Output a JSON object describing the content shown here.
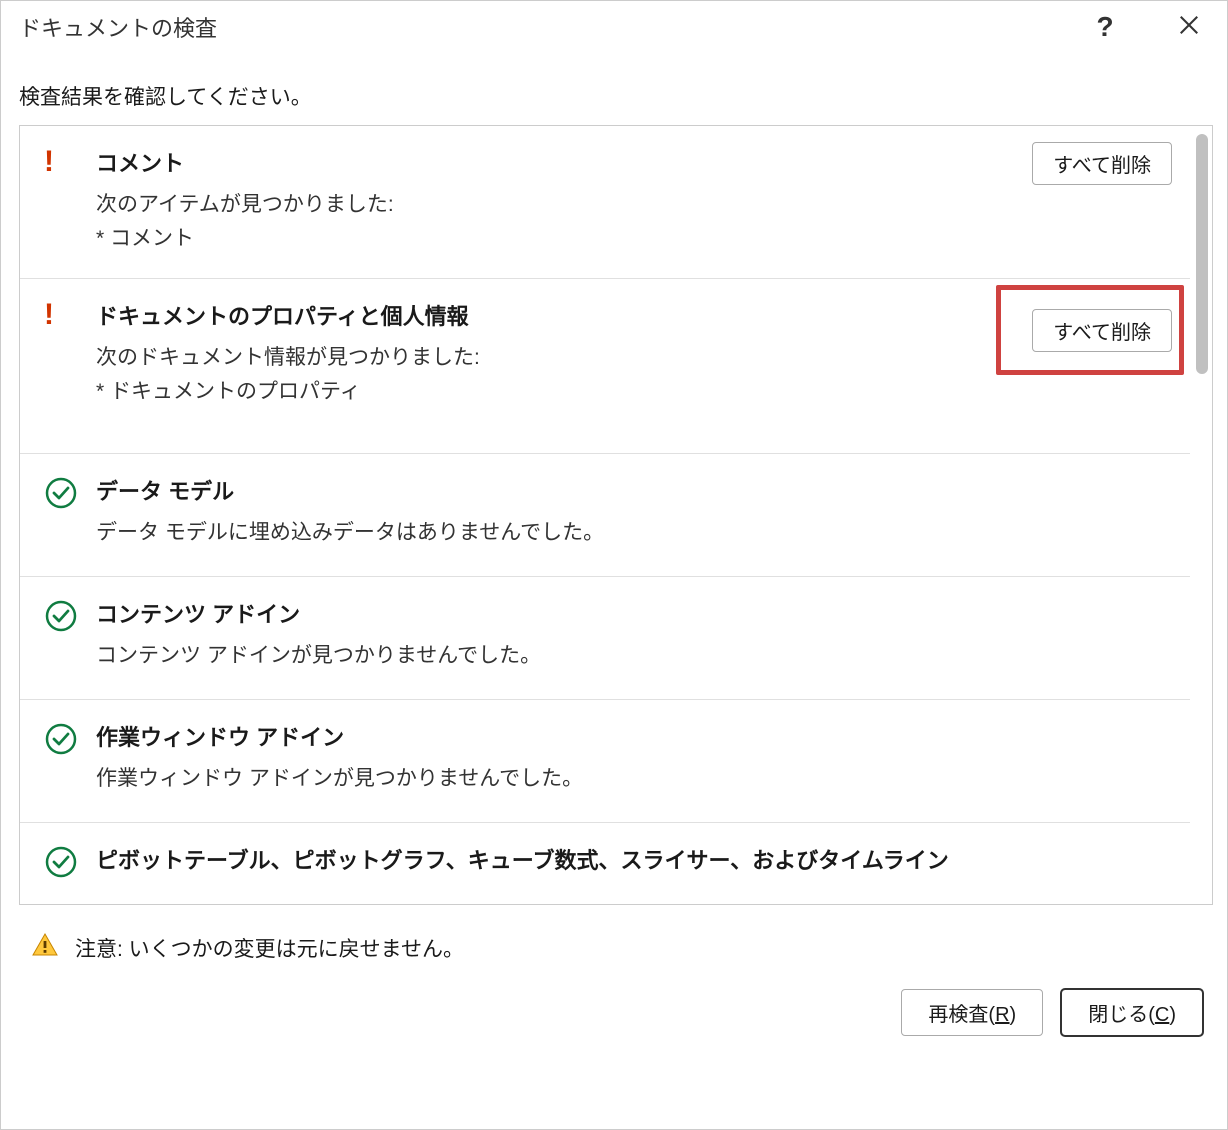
{
  "dialog": {
    "title": "ドキュメントの検査",
    "help_symbol": "?",
    "instruction": "検査結果を確認してください。"
  },
  "results": [
    {
      "status": "found",
      "title": "コメント",
      "description": "次のアイテムが見つかりました:",
      "detail": "* コメント",
      "remove_label": "すべて削除",
      "highlighted": false
    },
    {
      "status": "found",
      "title": "ドキュメントのプロパティと個人情報",
      "description": "次のドキュメント情報が見つかりました:",
      "detail": "* ドキュメントのプロパティ",
      "remove_label": "すべて削除",
      "highlighted": true
    },
    {
      "status": "ok",
      "title": "データ モデル",
      "description": "データ モデルに埋め込みデータはありませんでした。",
      "detail": "",
      "remove_label": "",
      "highlighted": false
    },
    {
      "status": "ok",
      "title": "コンテンツ アドイン",
      "description": "コンテンツ アドインが見つかりませんでした。",
      "detail": "",
      "remove_label": "",
      "highlighted": false
    },
    {
      "status": "ok",
      "title": "作業ウィンドウ アドイン",
      "description": "作業ウィンドウ アドインが見つかりませんでした。",
      "detail": "",
      "remove_label": "",
      "highlighted": false
    },
    {
      "status": "ok",
      "title": "ピボットテーブル、ピボットグラフ、キューブ数式、スライサー、およびタイムライン",
      "description": "",
      "detail": "",
      "remove_label": "",
      "highlighted": false
    }
  ],
  "footer": {
    "warning": "注意: いくつかの変更は元に戻せません。",
    "reinspect_label": "再検査(",
    "reinspect_key": "R",
    "reinspect_suffix": ")",
    "close_label": "閉じる(",
    "close_key": "C",
    "close_suffix": ")"
  }
}
